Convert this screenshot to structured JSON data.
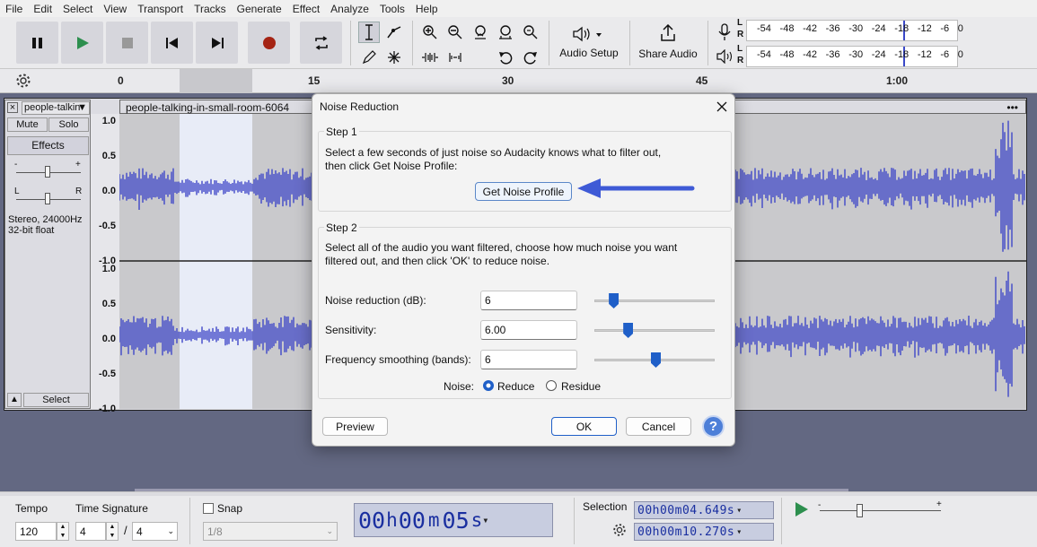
{
  "menu": [
    "File",
    "Edit",
    "Select",
    "View",
    "Transport",
    "Tracks",
    "Generate",
    "Effect",
    "Analyze",
    "Tools",
    "Help"
  ],
  "toolbar": {
    "audio_setup": "Audio Setup",
    "share_audio": "Share Audio",
    "meter_ticks": [
      "-54",
      "-48",
      "-42",
      "-36",
      "-30",
      "-24",
      "-18",
      "-12",
      "-6",
      "0"
    ],
    "rec_channels": [
      "L",
      "R"
    ]
  },
  "ruler": {
    "ticks": [
      "0",
      "15",
      "30",
      "45",
      "1:00"
    ]
  },
  "track": {
    "name": "people-talkin",
    "clip_name": "people-talking-in-small-room-6064",
    "mute": "Mute",
    "solo": "Solo",
    "effects": "Effects",
    "info1": "Stereo, 24000Hz",
    "info2": "32-bit float",
    "select": "Select",
    "gain_minus": "-",
    "gain_plus": "+",
    "pan_l": "L",
    "pan_r": "R",
    "scale": [
      "1.0",
      "0.5",
      "0.0",
      "-0.5",
      "-1.0"
    ]
  },
  "dialog": {
    "title": "Noise Reduction",
    "step1": {
      "label": "Step 1",
      "text1": "Select a few seconds of just noise so Audacity knows what to filter out,",
      "text2": "then click Get Noise Profile:",
      "button": "Get Noise Profile"
    },
    "step2": {
      "label": "Step 2",
      "text1": "Select all of the audio you want filtered, choose how much noise you want",
      "text2": "filtered out, and then click 'OK' to reduce noise."
    },
    "fields": [
      {
        "label": "Noise reduction (dB):",
        "value": "6",
        "level": 0.15
      },
      {
        "label": "Sensitivity:",
        "value": "6.00",
        "level": 0.27
      },
      {
        "label": "Frequency smoothing (bands):",
        "value": "6",
        "level": 0.5
      }
    ],
    "noise_label": "Noise:",
    "reduce": "Reduce",
    "residue": "Residue",
    "preview": "Preview",
    "ok": "OK",
    "cancel": "Cancel",
    "help": "?"
  },
  "bottom": {
    "tempo_label": "Tempo",
    "tempo": "120",
    "time_sig_label": "Time Signature",
    "sig_num": "4",
    "sig_den": "4",
    "snap": "Snap",
    "snap_value": "1/8",
    "time_display": [
      "00",
      "h",
      "00",
      "m",
      "05",
      "s"
    ],
    "selection_label": "Selection",
    "sel_start": "00h00m04.649s",
    "sel_end": "00h00m10.270s"
  }
}
